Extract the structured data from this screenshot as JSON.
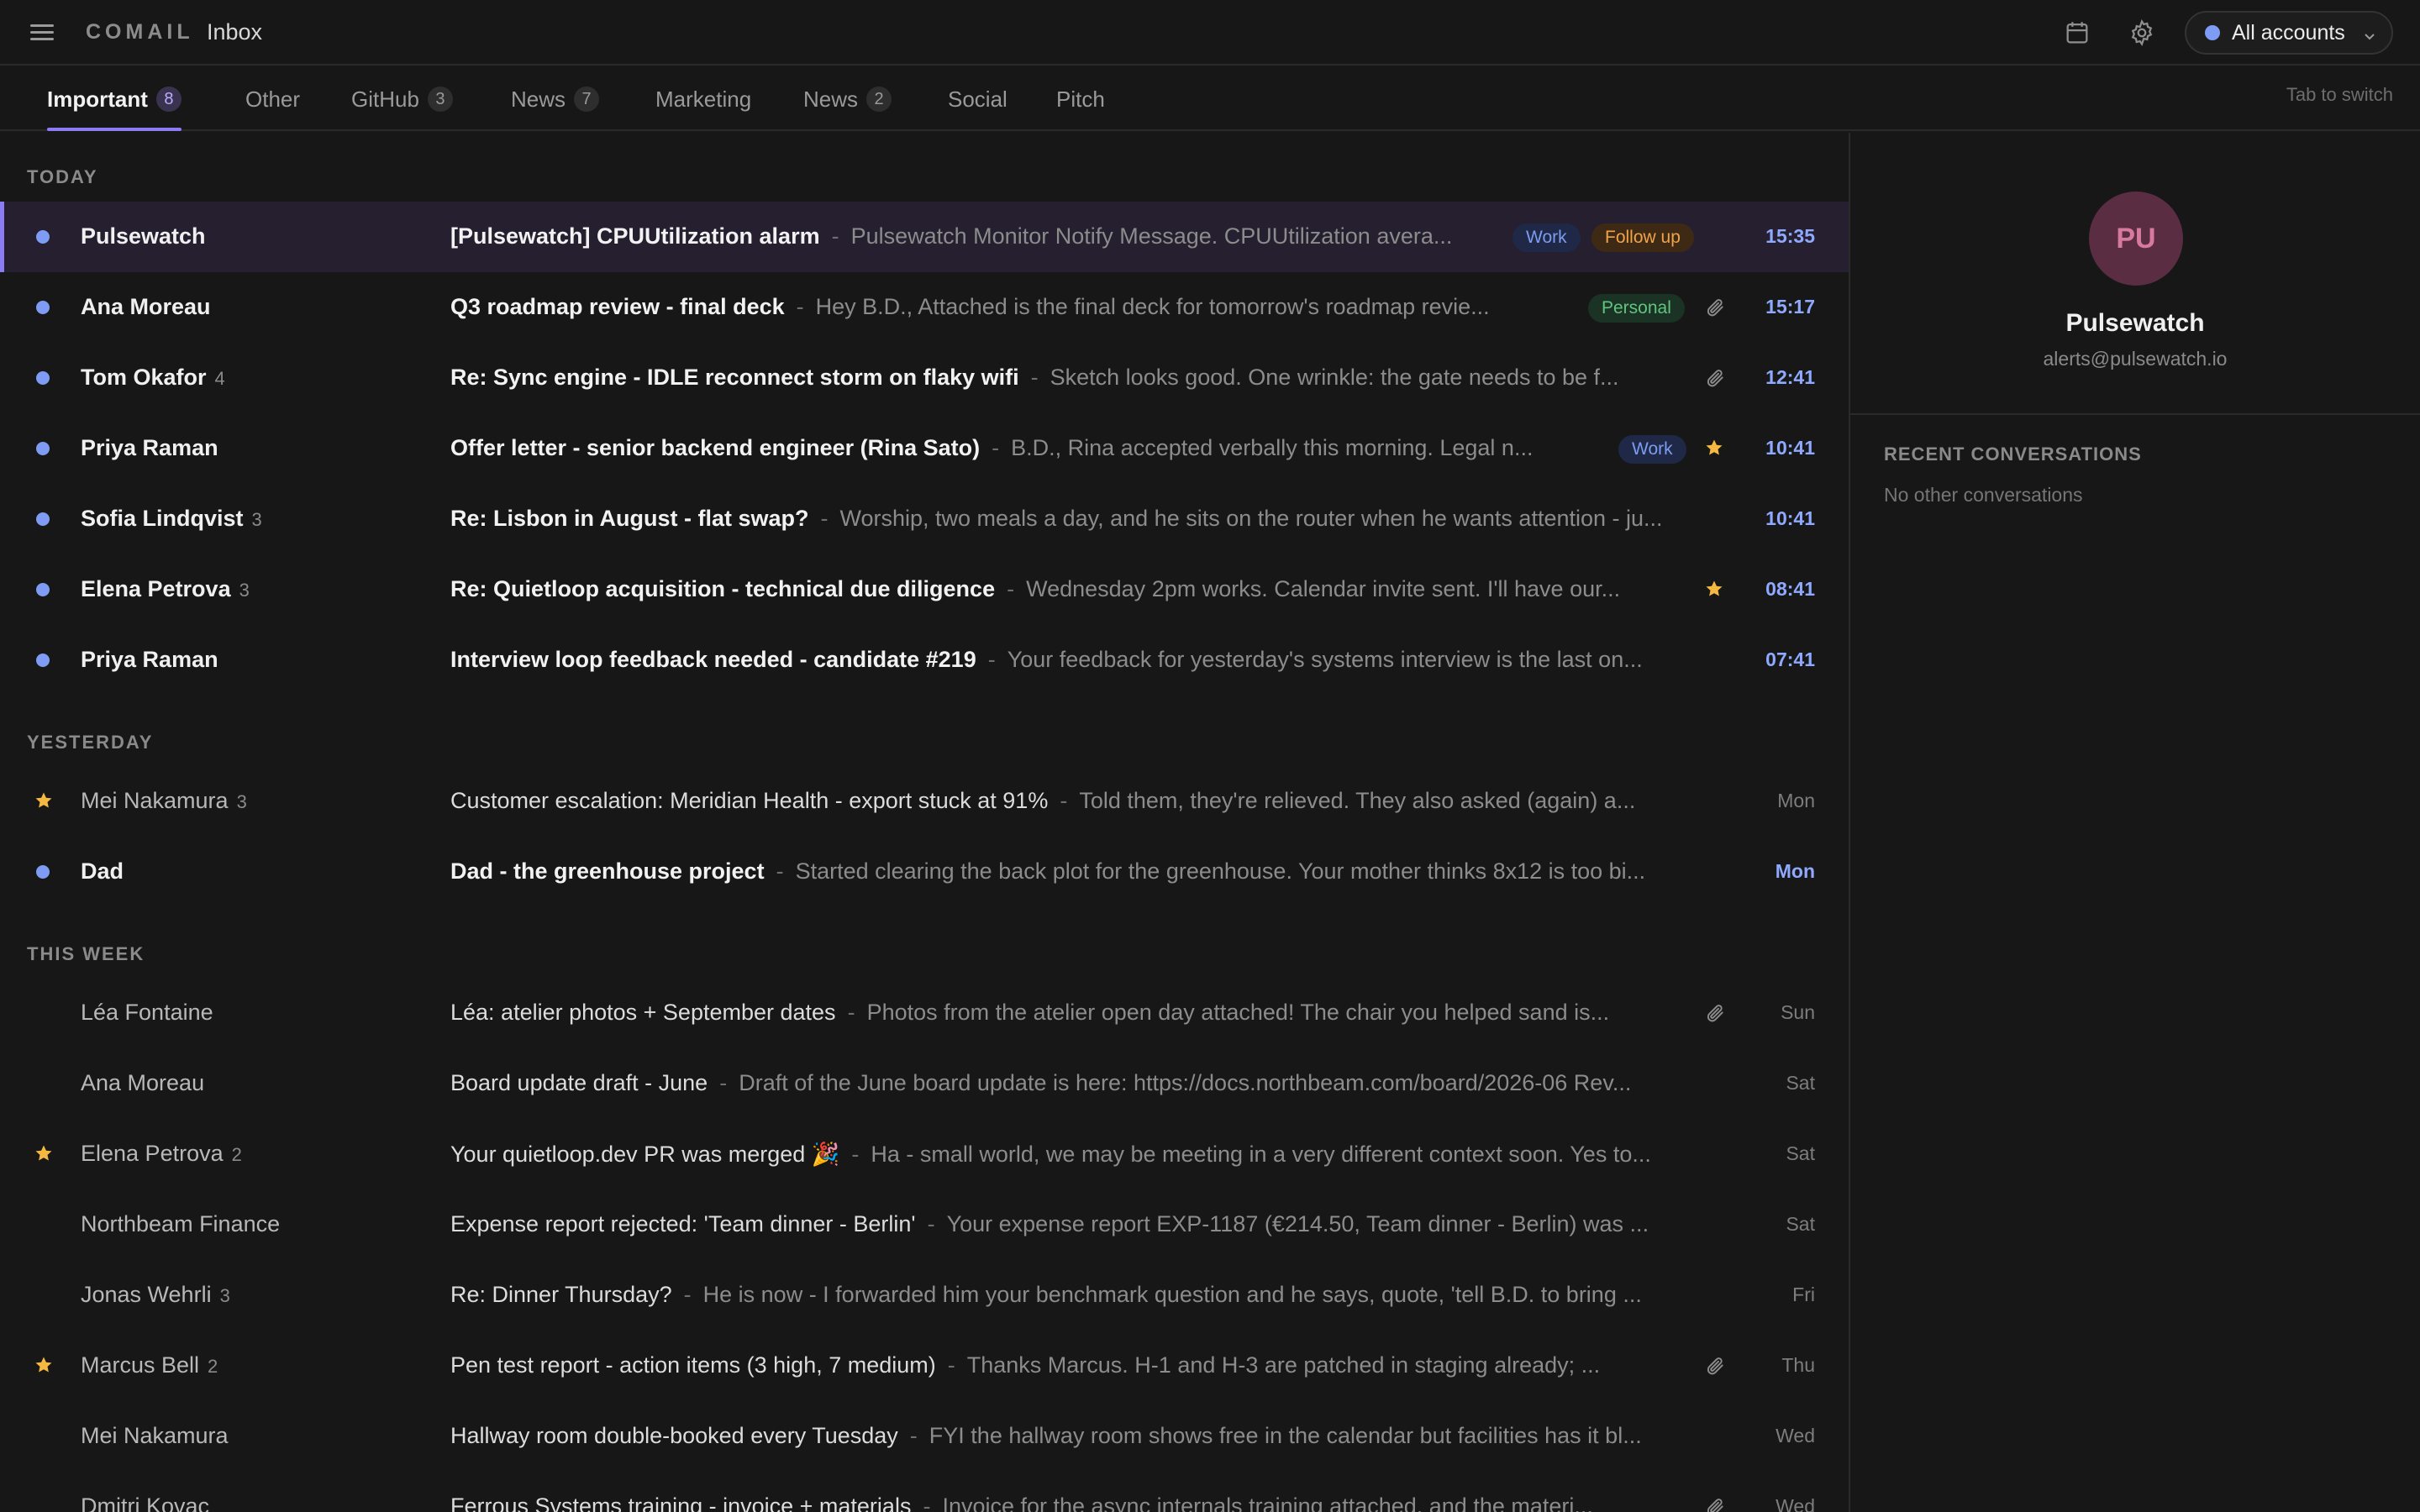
{
  "app": {
    "brand": "COMAIL",
    "title": "Inbox"
  },
  "topbar": {
    "accounts_label": "All accounts",
    "accounts_color": "#7f9cf5",
    "icons": [
      "menu-icon",
      "calendar-icon",
      "gear-icon",
      "chevron-down-icon"
    ]
  },
  "tabs": [
    {
      "label": "Important",
      "count": "8",
      "active": true
    },
    {
      "label": "Other",
      "count": ""
    },
    {
      "label": "GitHub",
      "count": "3"
    },
    {
      "label": "News",
      "count": "7"
    },
    {
      "label": "Marketing",
      "count": ""
    },
    {
      "label": "News",
      "count": "2"
    },
    {
      "label": "Social",
      "count": ""
    },
    {
      "label": "Pitch",
      "count": ""
    }
  ],
  "tab_hint": "Tab to switch",
  "sections": {
    "today": "TODAY",
    "yesterday": "YESTERDAY",
    "this_week": "THIS WEEK"
  },
  "emails": [
    {
      "sender": "Pulsewatch",
      "count": "",
      "unread": true,
      "starred": false,
      "selected": true,
      "subject": "[Pulsewatch] CPUUtilization alarm",
      "snippet": "Pulsewatch Monitor Notify Message. CPUUtilization avera...",
      "labels": [
        "Work",
        "Follow up"
      ],
      "attachment": false,
      "flag": false,
      "time": "15:35"
    },
    {
      "sender": "Ana Moreau",
      "count": "",
      "unread": true,
      "starred": false,
      "subject": "Q3 roadmap review - final deck",
      "snippet": "Hey B.D., Attached is the final deck for tomorrow's roadmap revie...",
      "labels": [
        "Personal"
      ],
      "attachment": true,
      "flag": false,
      "time": "15:17"
    },
    {
      "sender": "Tom Okafor",
      "count": "4",
      "unread": true,
      "starred": false,
      "subject": "Re: Sync engine - IDLE reconnect storm on flaky wifi",
      "snippet": "Sketch looks good. One wrinkle: the gate needs to be f...",
      "labels": [],
      "attachment": true,
      "flag": false,
      "time": "12:41"
    },
    {
      "sender": "Priya Raman",
      "count": "",
      "unread": true,
      "starred": false,
      "subject": "Offer letter - senior backend engineer (Rina Sato)",
      "snippet": "B.D., Rina accepted verbally this morning. Legal n...",
      "labels": [
        "Work"
      ],
      "attachment": false,
      "flag": true,
      "time": "10:41"
    },
    {
      "sender": "Sofia Lindqvist",
      "count": "3",
      "unread": true,
      "starred": false,
      "subject": "Re: Lisbon in August - flat swap?",
      "snippet": "Worship, two meals a day, and he sits on the router when he wants attention - ju...",
      "labels": [],
      "attachment": false,
      "flag": false,
      "time": "10:41"
    },
    {
      "sender": "Elena Petrova",
      "count": "3",
      "unread": true,
      "starred": false,
      "subject": "Re: Quietloop acquisition - technical due diligence",
      "snippet": "Wednesday 2pm works. Calendar invite sent. I'll have our...",
      "labels": [],
      "attachment": false,
      "flag": true,
      "time": "08:41"
    },
    {
      "sender": "Priya Raman",
      "count": "",
      "unread": true,
      "starred": false,
      "subject": "Interview loop feedback needed - candidate #219",
      "snippet": "Your feedback for yesterday's systems interview is the last on...",
      "labels": [],
      "attachment": false,
      "flag": false,
      "time": "07:41"
    },
    {
      "sender": "Mei Nakamura",
      "count": "3",
      "unread": false,
      "starred": true,
      "subject": "Customer escalation: Meridian Health - export stuck at 91%",
      "snippet": "Told them, they're relieved. They also asked (again) a...",
      "labels": [],
      "attachment": false,
      "flag": false,
      "time": "Mon"
    },
    {
      "sender": "Dad",
      "count": "",
      "unread": true,
      "starred": false,
      "subject": "Dad - the greenhouse project",
      "snippet": "Started clearing the back plot for the greenhouse. Your mother thinks 8x12 is too bi...",
      "labels": [],
      "attachment": false,
      "flag": false,
      "time": "Mon"
    },
    {
      "sender": "Léa Fontaine",
      "count": "",
      "unread": false,
      "starred": false,
      "subject": "Léa: atelier photos + September dates",
      "snippet": "Photos from the atelier open day attached! The chair you helped sand is...",
      "labels": [],
      "attachment": true,
      "flag": false,
      "time": "Sun"
    },
    {
      "sender": "Ana Moreau",
      "count": "",
      "unread": false,
      "starred": false,
      "subject": "Board update draft - June",
      "snippet": "Draft of the June board update is here: https://docs.northbeam.com/board/2026-06 Rev...",
      "labels": [],
      "attachment": false,
      "flag": false,
      "time": "Sat"
    },
    {
      "sender": "Elena Petrova",
      "count": "2",
      "unread": false,
      "starred": true,
      "subject": "Your quietloop.dev PR was merged 🎉",
      "snippet": "Ha - small world, we may be meeting in a very different context soon. Yes to...",
      "labels": [],
      "attachment": false,
      "flag": false,
      "time": "Sat"
    },
    {
      "sender": "Northbeam Finance",
      "count": "",
      "unread": false,
      "starred": false,
      "subject": "Expense report rejected: 'Team dinner - Berlin'",
      "snippet": "Your expense report EXP-1187 (€214.50, Team dinner - Berlin) was ...",
      "labels": [],
      "attachment": false,
      "flag": false,
      "time": "Sat"
    },
    {
      "sender": "Jonas Wehrli",
      "count": "3",
      "unread": false,
      "starred": false,
      "subject": "Re: Dinner Thursday?",
      "snippet": "He is now - I forwarded him your benchmark question and he says, quote, 'tell B.D. to bring ...",
      "labels": [],
      "attachment": false,
      "flag": false,
      "time": "Fri"
    },
    {
      "sender": "Marcus Bell",
      "count": "2",
      "unread": false,
      "starred": true,
      "subject": "Pen test report - action items (3 high, 7 medium)",
      "snippet": "Thanks Marcus. H-1 and H-3 are patched in staging already; ...",
      "labels": [],
      "attachment": true,
      "flag": false,
      "time": "Thu"
    },
    {
      "sender": "Mei Nakamura",
      "count": "",
      "unread": false,
      "starred": false,
      "subject": "Hallway room double-booked every Tuesday",
      "snippet": "FYI the hallway room shows free in the calendar but facilities has it bl...",
      "labels": [],
      "attachment": false,
      "flag": false,
      "time": "Wed"
    },
    {
      "sender": "Dmitri Kovac",
      "count": "",
      "unread": false,
      "starred": false,
      "subject": "Ferrous Systems training - invoice + materials",
      "snippet": "Invoice for the async internals training attached, and the materi...",
      "labels": [],
      "attachment": true,
      "flag": false,
      "time": "Wed"
    }
  ],
  "colors": {
    "accent": "#8b7cf6",
    "unread_dot": "#7f9cf5",
    "star": "#f5b942",
    "label_work": "#7c9cf0",
    "label_follow_up": "#f0a34a",
    "label_personal": "#62c47e"
  },
  "contact": {
    "initials": "PU",
    "name": "Pulsewatch",
    "email": "alerts@pulsewatch.io",
    "recent_title": "RECENT CONVERSATIONS",
    "recent_empty": "No other conversations"
  }
}
